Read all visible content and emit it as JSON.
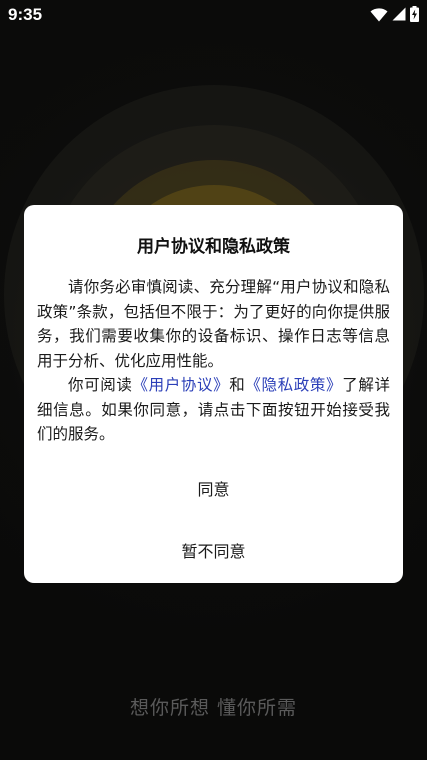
{
  "status_bar": {
    "time": "9:35",
    "icons": [
      "wifi-icon",
      "signal-icon",
      "battery-charging-icon"
    ]
  },
  "dialog": {
    "title": "用户协议和隐私政策",
    "para1": "请你务必审慎阅读、充分理解“用户协议和隐私政策”条款，包括但不限于：为了更好的向你提供服务，我们需要收集你的设备标识、操作日志等信息用于分析、优化应用性能。",
    "para2_prefix": "你可阅读",
    "user_agreement_link": "《用户协议》",
    "para2_and": "和",
    "privacy_policy_link": "《隐私政策》",
    "para2_suffix": "了解详细信息。如果你同意，请点击下面按钮开始接受我们的服务。",
    "agree_label": "同意",
    "disagree_label": "暂不同意"
  },
  "slogan": "想你所想 懂你所需",
  "colors": {
    "link": "#2b3fb8",
    "dialog_bg": "#ffffff",
    "page_bg": "#0a0a09"
  }
}
